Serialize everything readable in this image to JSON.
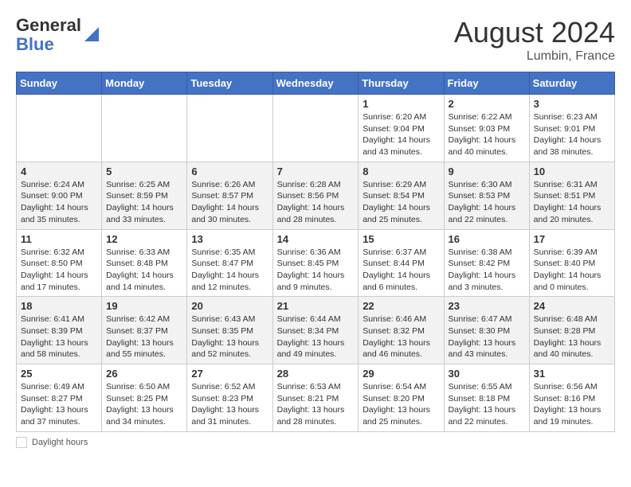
{
  "header": {
    "logo_line1": "General",
    "logo_line2": "Blue",
    "month": "August 2024",
    "location": "Lumbin, France"
  },
  "days_of_week": [
    "Sunday",
    "Monday",
    "Tuesday",
    "Wednesday",
    "Thursday",
    "Friday",
    "Saturday"
  ],
  "weeks": [
    [
      {
        "day": "",
        "info": ""
      },
      {
        "day": "",
        "info": ""
      },
      {
        "day": "",
        "info": ""
      },
      {
        "day": "",
        "info": ""
      },
      {
        "day": "1",
        "info": "Sunrise: 6:20 AM\nSunset: 9:04 PM\nDaylight: 14 hours and 43 minutes."
      },
      {
        "day": "2",
        "info": "Sunrise: 6:22 AM\nSunset: 9:03 PM\nDaylight: 14 hours and 40 minutes."
      },
      {
        "day": "3",
        "info": "Sunrise: 6:23 AM\nSunset: 9:01 PM\nDaylight: 14 hours and 38 minutes."
      }
    ],
    [
      {
        "day": "4",
        "info": "Sunrise: 6:24 AM\nSunset: 9:00 PM\nDaylight: 14 hours and 35 minutes."
      },
      {
        "day": "5",
        "info": "Sunrise: 6:25 AM\nSunset: 8:59 PM\nDaylight: 14 hours and 33 minutes."
      },
      {
        "day": "6",
        "info": "Sunrise: 6:26 AM\nSunset: 8:57 PM\nDaylight: 14 hours and 30 minutes."
      },
      {
        "day": "7",
        "info": "Sunrise: 6:28 AM\nSunset: 8:56 PM\nDaylight: 14 hours and 28 minutes."
      },
      {
        "day": "8",
        "info": "Sunrise: 6:29 AM\nSunset: 8:54 PM\nDaylight: 14 hours and 25 minutes."
      },
      {
        "day": "9",
        "info": "Sunrise: 6:30 AM\nSunset: 8:53 PM\nDaylight: 14 hours and 22 minutes."
      },
      {
        "day": "10",
        "info": "Sunrise: 6:31 AM\nSunset: 8:51 PM\nDaylight: 14 hours and 20 minutes."
      }
    ],
    [
      {
        "day": "11",
        "info": "Sunrise: 6:32 AM\nSunset: 8:50 PM\nDaylight: 14 hours and 17 minutes."
      },
      {
        "day": "12",
        "info": "Sunrise: 6:33 AM\nSunset: 8:48 PM\nDaylight: 14 hours and 14 minutes."
      },
      {
        "day": "13",
        "info": "Sunrise: 6:35 AM\nSunset: 8:47 PM\nDaylight: 14 hours and 12 minutes."
      },
      {
        "day": "14",
        "info": "Sunrise: 6:36 AM\nSunset: 8:45 PM\nDaylight: 14 hours and 9 minutes."
      },
      {
        "day": "15",
        "info": "Sunrise: 6:37 AM\nSunset: 8:44 PM\nDaylight: 14 hours and 6 minutes."
      },
      {
        "day": "16",
        "info": "Sunrise: 6:38 AM\nSunset: 8:42 PM\nDaylight: 14 hours and 3 minutes."
      },
      {
        "day": "17",
        "info": "Sunrise: 6:39 AM\nSunset: 8:40 PM\nDaylight: 14 hours and 0 minutes."
      }
    ],
    [
      {
        "day": "18",
        "info": "Sunrise: 6:41 AM\nSunset: 8:39 PM\nDaylight: 13 hours and 58 minutes."
      },
      {
        "day": "19",
        "info": "Sunrise: 6:42 AM\nSunset: 8:37 PM\nDaylight: 13 hours and 55 minutes."
      },
      {
        "day": "20",
        "info": "Sunrise: 6:43 AM\nSunset: 8:35 PM\nDaylight: 13 hours and 52 minutes."
      },
      {
        "day": "21",
        "info": "Sunrise: 6:44 AM\nSunset: 8:34 PM\nDaylight: 13 hours and 49 minutes."
      },
      {
        "day": "22",
        "info": "Sunrise: 6:46 AM\nSunset: 8:32 PM\nDaylight: 13 hours and 46 minutes."
      },
      {
        "day": "23",
        "info": "Sunrise: 6:47 AM\nSunset: 8:30 PM\nDaylight: 13 hours and 43 minutes."
      },
      {
        "day": "24",
        "info": "Sunrise: 6:48 AM\nSunset: 8:28 PM\nDaylight: 13 hours and 40 minutes."
      }
    ],
    [
      {
        "day": "25",
        "info": "Sunrise: 6:49 AM\nSunset: 8:27 PM\nDaylight: 13 hours and 37 minutes."
      },
      {
        "day": "26",
        "info": "Sunrise: 6:50 AM\nSunset: 8:25 PM\nDaylight: 13 hours and 34 minutes."
      },
      {
        "day": "27",
        "info": "Sunrise: 6:52 AM\nSunset: 8:23 PM\nDaylight: 13 hours and 31 minutes."
      },
      {
        "day": "28",
        "info": "Sunrise: 6:53 AM\nSunset: 8:21 PM\nDaylight: 13 hours and 28 minutes."
      },
      {
        "day": "29",
        "info": "Sunrise: 6:54 AM\nSunset: 8:20 PM\nDaylight: 13 hours and 25 minutes."
      },
      {
        "day": "30",
        "info": "Sunrise: 6:55 AM\nSunset: 8:18 PM\nDaylight: 13 hours and 22 minutes."
      },
      {
        "day": "31",
        "info": "Sunrise: 6:56 AM\nSunset: 8:16 PM\nDaylight: 13 hours and 19 minutes."
      }
    ]
  ],
  "footer": {
    "daylight_label": "Daylight hours"
  }
}
